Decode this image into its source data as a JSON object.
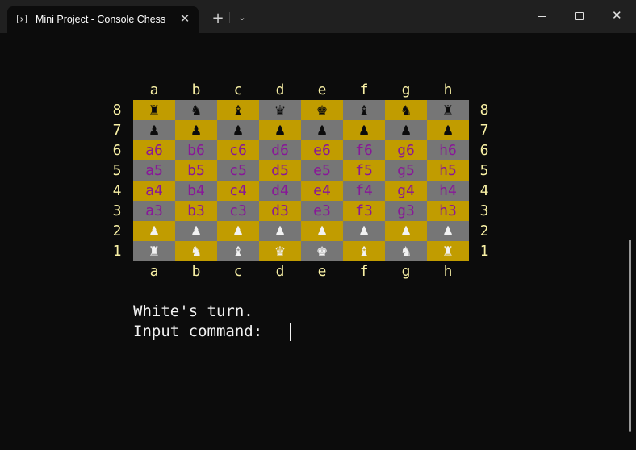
{
  "window": {
    "tab_title": "Mini Project - Console Chess.exe",
    "tab_close_symbol": "✕",
    "new_tab_symbol": "+",
    "dropdown_symbol": "⌄",
    "close_symbol": "✕"
  },
  "board": {
    "files": [
      "a",
      "b",
      "c",
      "d",
      "e",
      "f",
      "g",
      "h"
    ],
    "ranks": [
      "8",
      "7",
      "6",
      "5",
      "4",
      "3",
      "2",
      "1"
    ],
    "colors": {
      "light": "#c19c00",
      "dark": "#767676",
      "label": "#f9f1a5",
      "coord_text": "#881798",
      "black_piece": "#0c0c0c",
      "white_piece": "#f2f2f2"
    },
    "rows": [
      [
        "♜",
        "♞",
        "♝",
        "♛",
        "♚",
        "♝",
        "♞",
        "♜"
      ],
      [
        "♟",
        "♟",
        "♟",
        "♟",
        "♟",
        "♟",
        "♟",
        "♟"
      ],
      [
        "a6",
        "b6",
        "c6",
        "d6",
        "e6",
        "f6",
        "g6",
        "h6"
      ],
      [
        "a5",
        "b5",
        "c5",
        "d5",
        "e5",
        "f5",
        "g5",
        "h5"
      ],
      [
        "a4",
        "b4",
        "c4",
        "d4",
        "e4",
        "f4",
        "g4",
        "h4"
      ],
      [
        "a3",
        "b3",
        "c3",
        "d3",
        "e3",
        "f3",
        "g3",
        "h3"
      ],
      [
        "♟",
        "♟",
        "♟",
        "♟",
        "♟",
        "♟",
        "♟",
        "♟"
      ],
      [
        "♜",
        "♞",
        "♝",
        "♛",
        "♚",
        "♝",
        "♞",
        "♜"
      ]
    ],
    "row_types": [
      "black",
      "black",
      "coord",
      "coord",
      "coord",
      "coord",
      "white",
      "white"
    ]
  },
  "console": {
    "turn_text": "White's turn.",
    "prompt_text": "Input command: "
  }
}
